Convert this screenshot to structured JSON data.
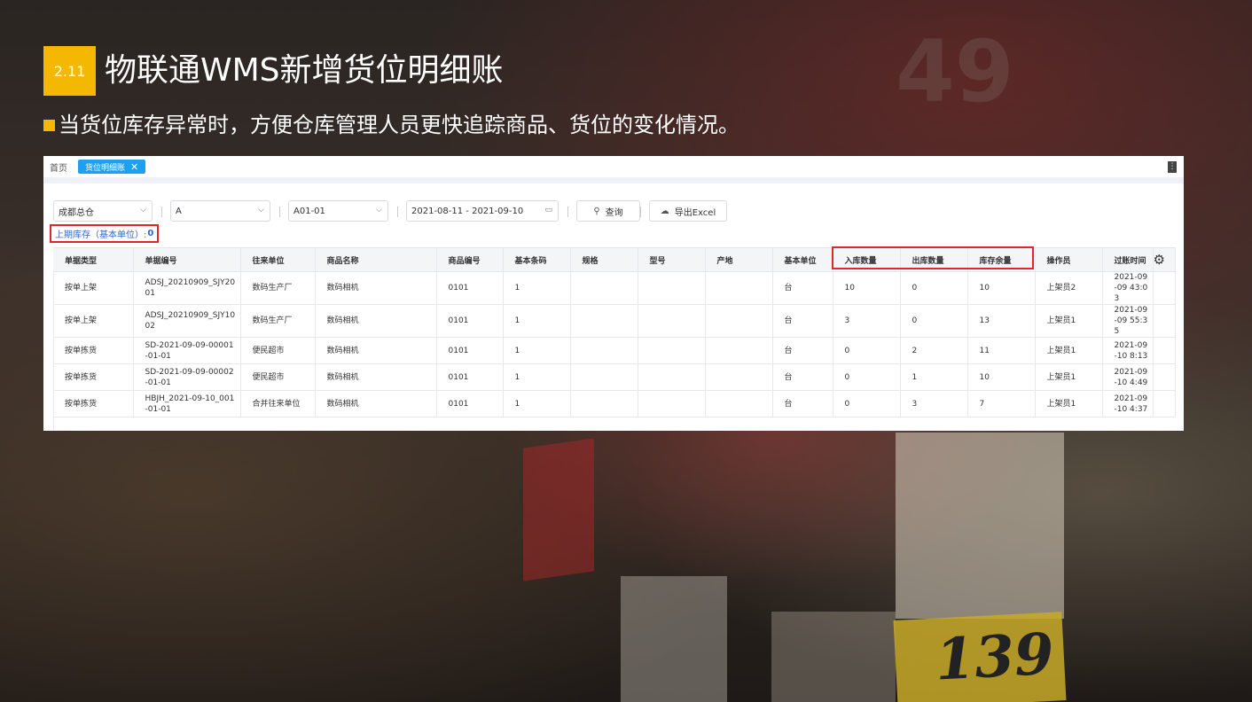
{
  "header": {
    "badge": "2.11",
    "title": "物联通WMS新增货位明细账",
    "subtitle": "当货位库存异常时，方便仓库管理人员更快追踪商品、货位的变化情况。"
  },
  "tabs": {
    "home": "首页",
    "active": "货位明细账",
    "close": "✕"
  },
  "filters": {
    "warehouse": "成都总仓",
    "area": "A",
    "location": "A01-01",
    "date_range": "2021-08-11 - 2021-09-10",
    "search_button": "查询",
    "export_button": "导出Excel"
  },
  "prev_stock": {
    "label": "上期库存（基本单位）:",
    "value": "0"
  },
  "table": {
    "columns": [
      "单据类型",
      "单据编号",
      "往来单位",
      "商品名称",
      "商品编号",
      "基本条码",
      "规格",
      "型号",
      "产地",
      "基本单位",
      "入库数量",
      "出库数量",
      "库存余量",
      "操作员",
      "过账时间"
    ],
    "rows": [
      [
        "按单上架",
        "ADSJ_20210909_SJY2001",
        "数码生产厂",
        "数码相机",
        "0101",
        "1",
        "",
        "",
        "",
        "台",
        "10",
        "0",
        "10",
        "上架员2",
        "2021-09-09 43:03"
      ],
      [
        "按单上架",
        "ADSJ_20210909_SJY1002",
        "数码生产厂",
        "数码相机",
        "0101",
        "1",
        "",
        "",
        "",
        "台",
        "3",
        "0",
        "13",
        "上架员1",
        "2021-09-09 55:35"
      ],
      [
        "按单拣货",
        "SD-2021-09-09-00001-01-01",
        "便民超市",
        "数码相机",
        "0101",
        "1",
        "",
        "",
        "",
        "台",
        "0",
        "2",
        "11",
        "上架员1",
        "2021-09-10 8:13"
      ],
      [
        "按单拣货",
        "SD-2021-09-09-00002-01-01",
        "便民超市",
        "数码相机",
        "0101",
        "1",
        "",
        "",
        "",
        "台",
        "0",
        "1",
        "10",
        "上架员1",
        "2021-09-10 4:49"
      ],
      [
        "按单拣货",
        "HBJH_2021-09-10_001-01-01",
        "合并往来单位",
        "数码相机",
        "0101",
        "1",
        "",
        "",
        "",
        "台",
        "0",
        "3",
        "7",
        "上架员1",
        "2021-09-10 4:37"
      ]
    ]
  },
  "background": {
    "number": "49",
    "price": "139"
  },
  "colors": {
    "badge": "#f5b800",
    "tab_active": "#1ea0f0",
    "highlight": "#e0262d"
  }
}
